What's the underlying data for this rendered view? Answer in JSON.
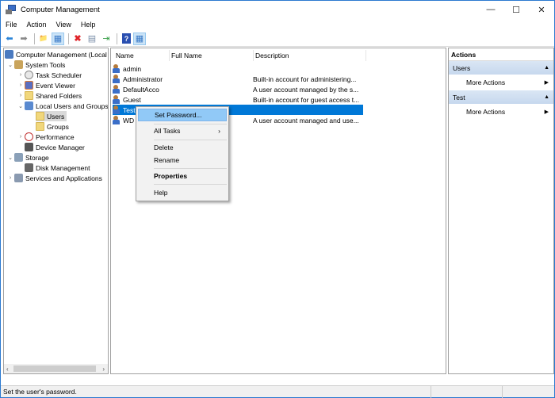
{
  "window": {
    "title": "Computer Management",
    "controls": {
      "minimize": "—",
      "maximize": "☐",
      "close": "✕"
    }
  },
  "menu": [
    "File",
    "Action",
    "View",
    "Help"
  ],
  "toolbar": [
    {
      "icon": "back-arrow-icon",
      "glyph": "⬅"
    },
    {
      "icon": "forward-arrow-icon",
      "glyph": "➡"
    },
    {
      "icon": "up-folder-icon",
      "glyph": "📁"
    },
    {
      "icon": "show-hide-console-tree-icon",
      "glyph": "▦"
    },
    {
      "icon": "delete-icon",
      "glyph": "✖"
    },
    {
      "icon": "properties-icon",
      "glyph": "▤"
    },
    {
      "icon": "export-list-icon",
      "glyph": "⇥"
    },
    {
      "icon": "help-icon",
      "glyph": "?"
    },
    {
      "icon": "show-hide-action-pane-icon",
      "glyph": "▦"
    }
  ],
  "tree": [
    {
      "label": "Computer Management (Local",
      "expander": "",
      "level": 0
    },
    {
      "label": "System Tools",
      "expander": "⌄",
      "level": 1
    },
    {
      "label": "Task Scheduler",
      "expander": "›",
      "level": 2
    },
    {
      "label": "Event Viewer",
      "expander": "›",
      "level": 2
    },
    {
      "label": "Shared Folders",
      "expander": "›",
      "level": 2
    },
    {
      "label": "Local Users and Groups",
      "expander": "⌄",
      "level": 2
    },
    {
      "label": "Users",
      "expander": "",
      "level": 3,
      "selected": true
    },
    {
      "label": "Groups",
      "expander": "",
      "level": 3
    },
    {
      "label": "Performance",
      "expander": "›",
      "level": 2
    },
    {
      "label": "Device Manager",
      "expander": "",
      "level": 2
    },
    {
      "label": "Storage",
      "expander": "⌄",
      "level": 1
    },
    {
      "label": "Disk Management",
      "expander": "",
      "level": 2
    },
    {
      "label": "Services and Applications",
      "expander": "›",
      "level": 1
    }
  ],
  "list": {
    "columns": [
      "Name",
      "Full Name",
      "Description"
    ],
    "rows": [
      {
        "name": "admin",
        "full_name": "",
        "description": ""
      },
      {
        "name": "Administrator",
        "full_name": "",
        "description": "Built-in account for administering..."
      },
      {
        "name": "DefaultAcco",
        "full_name": "",
        "description": "A user account managed by the s..."
      },
      {
        "name": "Guest",
        "full_name": "",
        "description": "Built-in account for guest access t..."
      },
      {
        "name": "Test",
        "full_name": "",
        "description": "",
        "selected": true
      },
      {
        "name": "WD",
        "full_name": "",
        "description": "A user account managed and use..."
      }
    ]
  },
  "context_menu": {
    "set_password": "Set Password...",
    "all_tasks": "All Tasks",
    "delete": "Delete",
    "rename": "Rename",
    "properties": "Properties",
    "help": "Help",
    "submenu_arrow": "›"
  },
  "actions": {
    "title": "Actions",
    "sections": [
      {
        "header": "Users",
        "collapse": "▲",
        "item": "More Actions",
        "arrow": "▶"
      },
      {
        "header": "Test",
        "collapse": "▲",
        "item": "More Actions",
        "arrow": "▶"
      }
    ]
  },
  "status": {
    "text": "Set the user's password."
  },
  "scroll": {
    "left": "‹",
    "right": "›"
  }
}
